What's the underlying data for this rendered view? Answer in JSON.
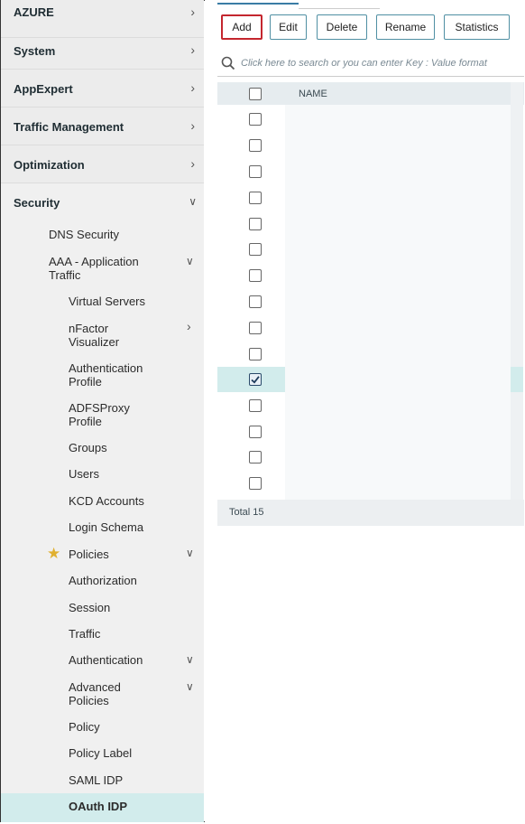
{
  "sidebar": {
    "top_items": [
      {
        "label": "AZURE"
      },
      {
        "label": "System"
      },
      {
        "label": "AppExpert"
      },
      {
        "label": "Traffic Management"
      },
      {
        "label": "Optimization"
      }
    ],
    "security": {
      "label": "Security",
      "children": {
        "dns_security": "DNS Security",
        "aaa_traffic": "AAA - Application Traffic",
        "virtual_servers": "Virtual Servers",
        "nfactor_visualizer": "nFactor Visualizer",
        "authentication_profile": "Authentication Profile",
        "adfsproxy_profile": "ADFSProxy Profile",
        "groups": "Groups",
        "users": "Users",
        "kcd_accounts": "KCD Accounts",
        "login_schema": "Login Schema",
        "policies": "Policies",
        "authorization": "Authorization",
        "session": "Session",
        "traffic": "Traffic",
        "authentication": "Authentication",
        "advanced_policies": "Advanced Policies",
        "policy": "Policy",
        "policy_label": "Policy Label",
        "saml_idp": "SAML IDP",
        "oauth_idp": "OAuth IDP"
      }
    }
  },
  "toolbar": {
    "add": "Add",
    "edit": "Edit",
    "delete": "Delete",
    "rename": "Rename",
    "statistics": "Statistics"
  },
  "search": {
    "placeholder": "Click here to search or you can enter Key : Value format"
  },
  "table": {
    "header_name": "NAME",
    "row_count_visible": 15,
    "checked_row_index": 10
  },
  "footer": {
    "total": "Total 15"
  },
  "colors": {
    "selected_highlight": "#d2ecec",
    "add_button_border": "#c4262e",
    "star": "#e0b030"
  }
}
